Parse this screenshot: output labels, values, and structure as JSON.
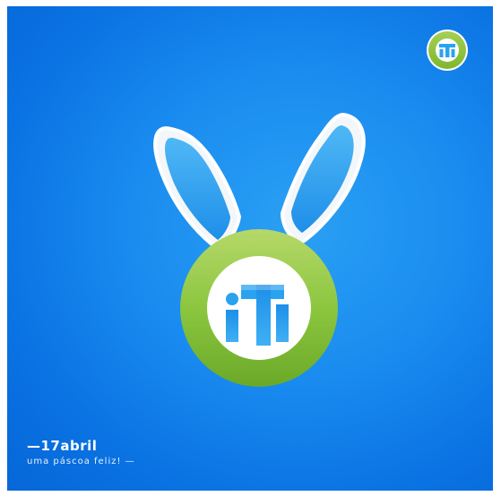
{
  "poster": {
    "background_color": "#0a78e6",
    "accent_green": "#8cc63f",
    "date_text": "—17abril",
    "tagline_text": "uma páscoa feliz! —",
    "logo_text": "iTi",
    "icons": [
      "iti-logo-icon",
      "bunny-ears-icon"
    ]
  }
}
